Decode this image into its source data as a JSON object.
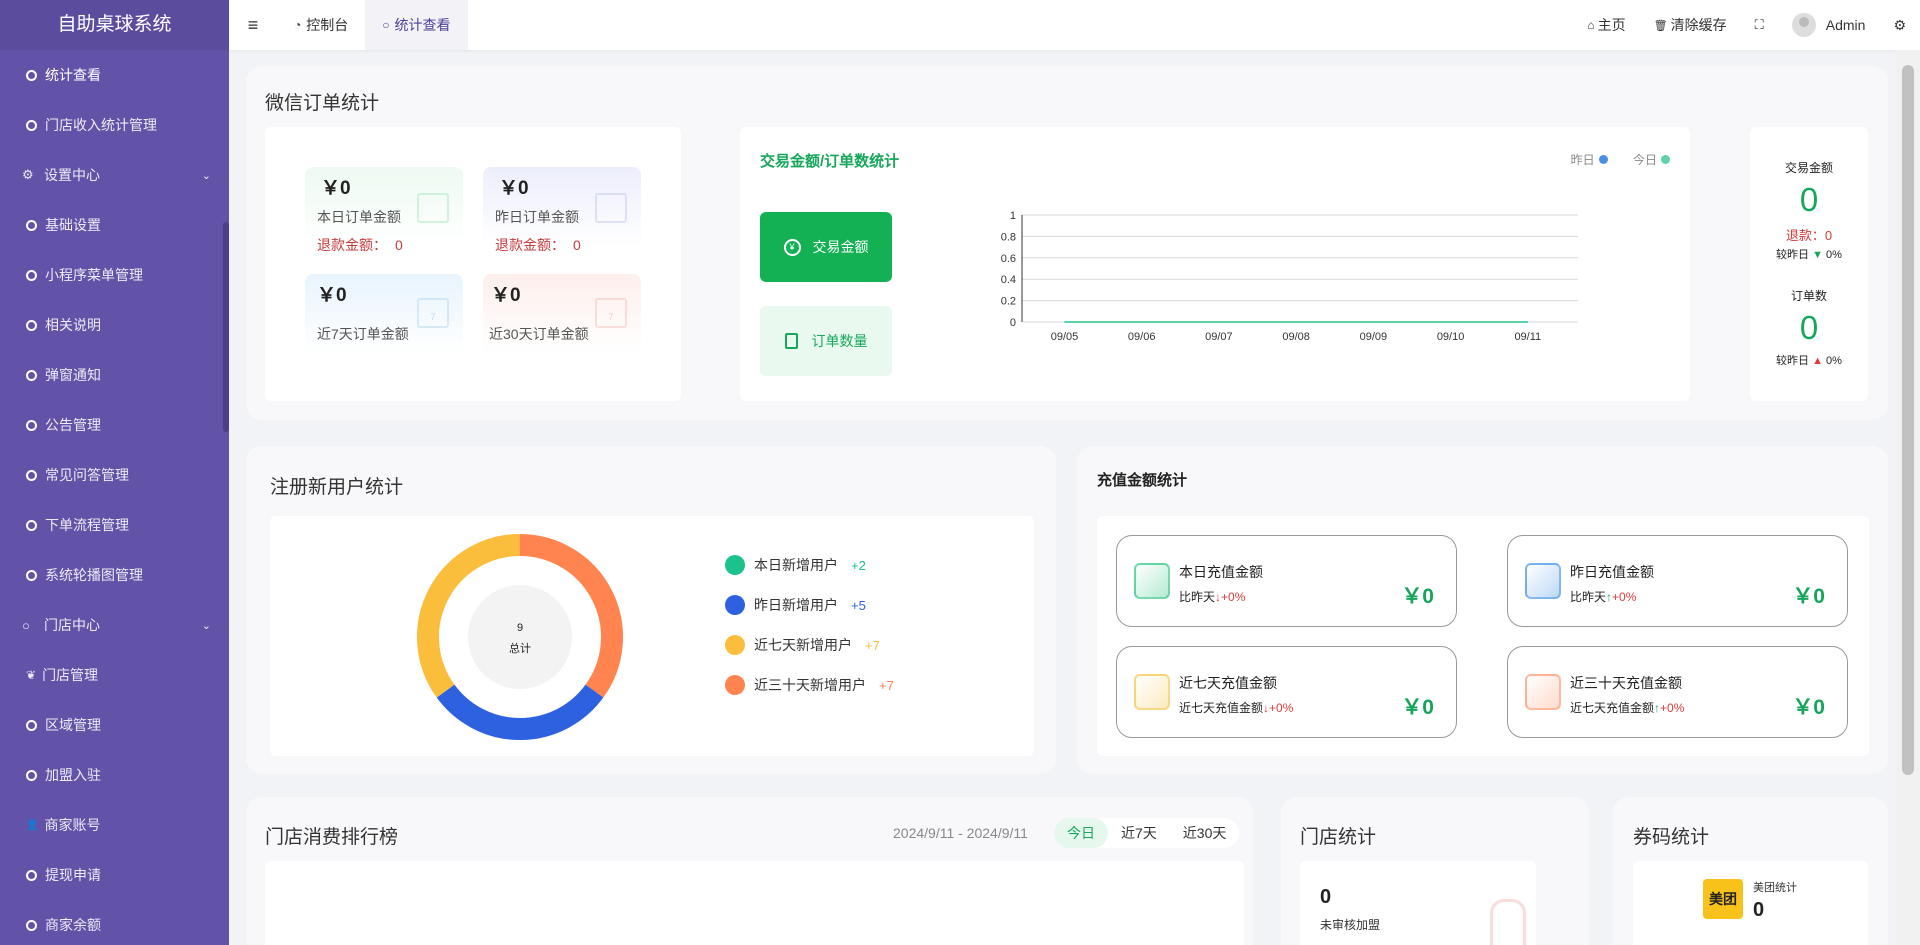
{
  "app": {
    "title": "自助桌球系统"
  },
  "sidebar": {
    "items": [
      {
        "label": "统计查看",
        "type": "item"
      },
      {
        "label": "门店收入统计管理",
        "type": "item"
      },
      {
        "label": "设置中心",
        "type": "group",
        "icon": "cogs-icon"
      },
      {
        "label": "基础设置",
        "type": "item"
      },
      {
        "label": "小程序菜单管理",
        "type": "item"
      },
      {
        "label": "相关说明",
        "type": "item"
      },
      {
        "label": "弹窗通知",
        "type": "item"
      },
      {
        "label": "公告管理",
        "type": "item"
      },
      {
        "label": "常见问答管理",
        "type": "item"
      },
      {
        "label": "下单流程管理",
        "type": "item"
      },
      {
        "label": "系统轮播图管理",
        "type": "item"
      },
      {
        "label": "门店中心",
        "type": "group",
        "icon": "circle-icon"
      },
      {
        "label": "门店管理",
        "type": "item",
        "icon": "leaf-icon"
      },
      {
        "label": "区域管理",
        "type": "item"
      },
      {
        "label": "加盟入驻",
        "type": "item"
      },
      {
        "label": "商家账号",
        "type": "item",
        "icon": "user-icon"
      },
      {
        "label": "提现申请",
        "type": "item"
      },
      {
        "label": "商家余额",
        "type": "item"
      }
    ]
  },
  "topbar": {
    "tabs": [
      {
        "label": "控制台",
        "icon": "dashboard-icon"
      },
      {
        "label": "统计查看",
        "icon": "circle-icon"
      }
    ],
    "right": {
      "home": "主页",
      "clear_cache": "清除缓存",
      "user": "Admin"
    }
  },
  "wechat": {
    "title": "微信订单统计",
    "cards": [
      {
        "amount": "￥0",
        "label": "本日订单金额",
        "refund_label": "退款金额：",
        "refund": "0"
      },
      {
        "amount": "￥0",
        "label": "昨日订单金额",
        "refund_label": "退款金额：",
        "refund": "0"
      },
      {
        "amount": "￥0",
        "label": "近7天订单金额"
      },
      {
        "amount": "￥0",
        "label": "近30天订单金额"
      }
    ],
    "calendar_marks": [
      "7",
      "7"
    ],
    "trade_title": "交易金额/订单数统计",
    "legend": {
      "yesterday": "昨日",
      "today": "今日"
    },
    "btn_amount": "交易金额",
    "btn_count": "订单数量",
    "summary": {
      "amount_label": "交易金额",
      "amount": "0",
      "refund": "退款：0",
      "compare": "较昨日",
      "pct1": "0%",
      "orders_label": "订单数",
      "orders": "0",
      "pct2": "0%"
    }
  },
  "chart_data": {
    "type": "line",
    "title": "交易金额/订单数统计",
    "categories": [
      "09/05",
      "09/06",
      "09/07",
      "09/08",
      "09/09",
      "09/10",
      "09/11"
    ],
    "series": [
      {
        "name": "昨日",
        "values": [
          0,
          0,
          0,
          0,
          0,
          0,
          0
        ],
        "color": "#4a90e2"
      },
      {
        "name": "今日",
        "values": [
          0,
          0,
          0,
          0,
          0,
          0,
          0
        ],
        "color": "#5bd3a5"
      }
    ],
    "ylim": [
      0,
      1
    ],
    "yticks": [
      "0",
      "0.2",
      "0.4",
      "0.6",
      "0.8",
      "1"
    ],
    "grid": true
  },
  "users": {
    "title": "注册新用户统计",
    "total": "9",
    "total_label": "总计",
    "legend": [
      {
        "label": "本日新增用户",
        "value": "+2",
        "color": "#1bc38a"
      },
      {
        "label": "昨日新增用户",
        "value": "+5",
        "color": "#2d61e0"
      },
      {
        "label": "近七天新增用户",
        "value": "+7",
        "color": "#fbbd3c"
      },
      {
        "label": "近三十天新增用户",
        "value": "+7",
        "color": "#ff8450"
      }
    ],
    "donut_shares": [
      0,
      0.3,
      0.35,
      0.35
    ]
  },
  "recharge": {
    "title": "充值金额统计",
    "items": [
      {
        "title": "本日充值金额",
        "cmp": "比昨天",
        "pct": "+0%",
        "value": "￥0",
        "arrow": "↓",
        "icon_color": "#21c27a"
      },
      {
        "title": "昨日充值金额",
        "cmp": "比昨天",
        "pct": "+0%",
        "value": "￥0",
        "arrow": "↑",
        "icon_color": "#3a8de6"
      },
      {
        "title": "近七天充值金额",
        "cmp": "近七天充值金额",
        "pct": "+0%",
        "value": "￥0",
        "arrow": "↓",
        "icon_color": "#f7c23d"
      },
      {
        "title": "近三十天充值金额",
        "cmp": "近七天充值金额",
        "pct": "+0%",
        "value": "￥0",
        "arrow": "↑",
        "icon_color": "#ff9166"
      }
    ]
  },
  "ranking": {
    "title": "门店消费排行榜",
    "range": "2024/9/11 - 2024/9/11",
    "tabs": [
      "今日",
      "近7天",
      "近30天"
    ]
  },
  "store": {
    "title": "门店统计",
    "value": "0",
    "label": "未审核加盟"
  },
  "coupon": {
    "title": "券码统计",
    "badge": "美团",
    "label": "美团统计",
    "value": "0"
  }
}
